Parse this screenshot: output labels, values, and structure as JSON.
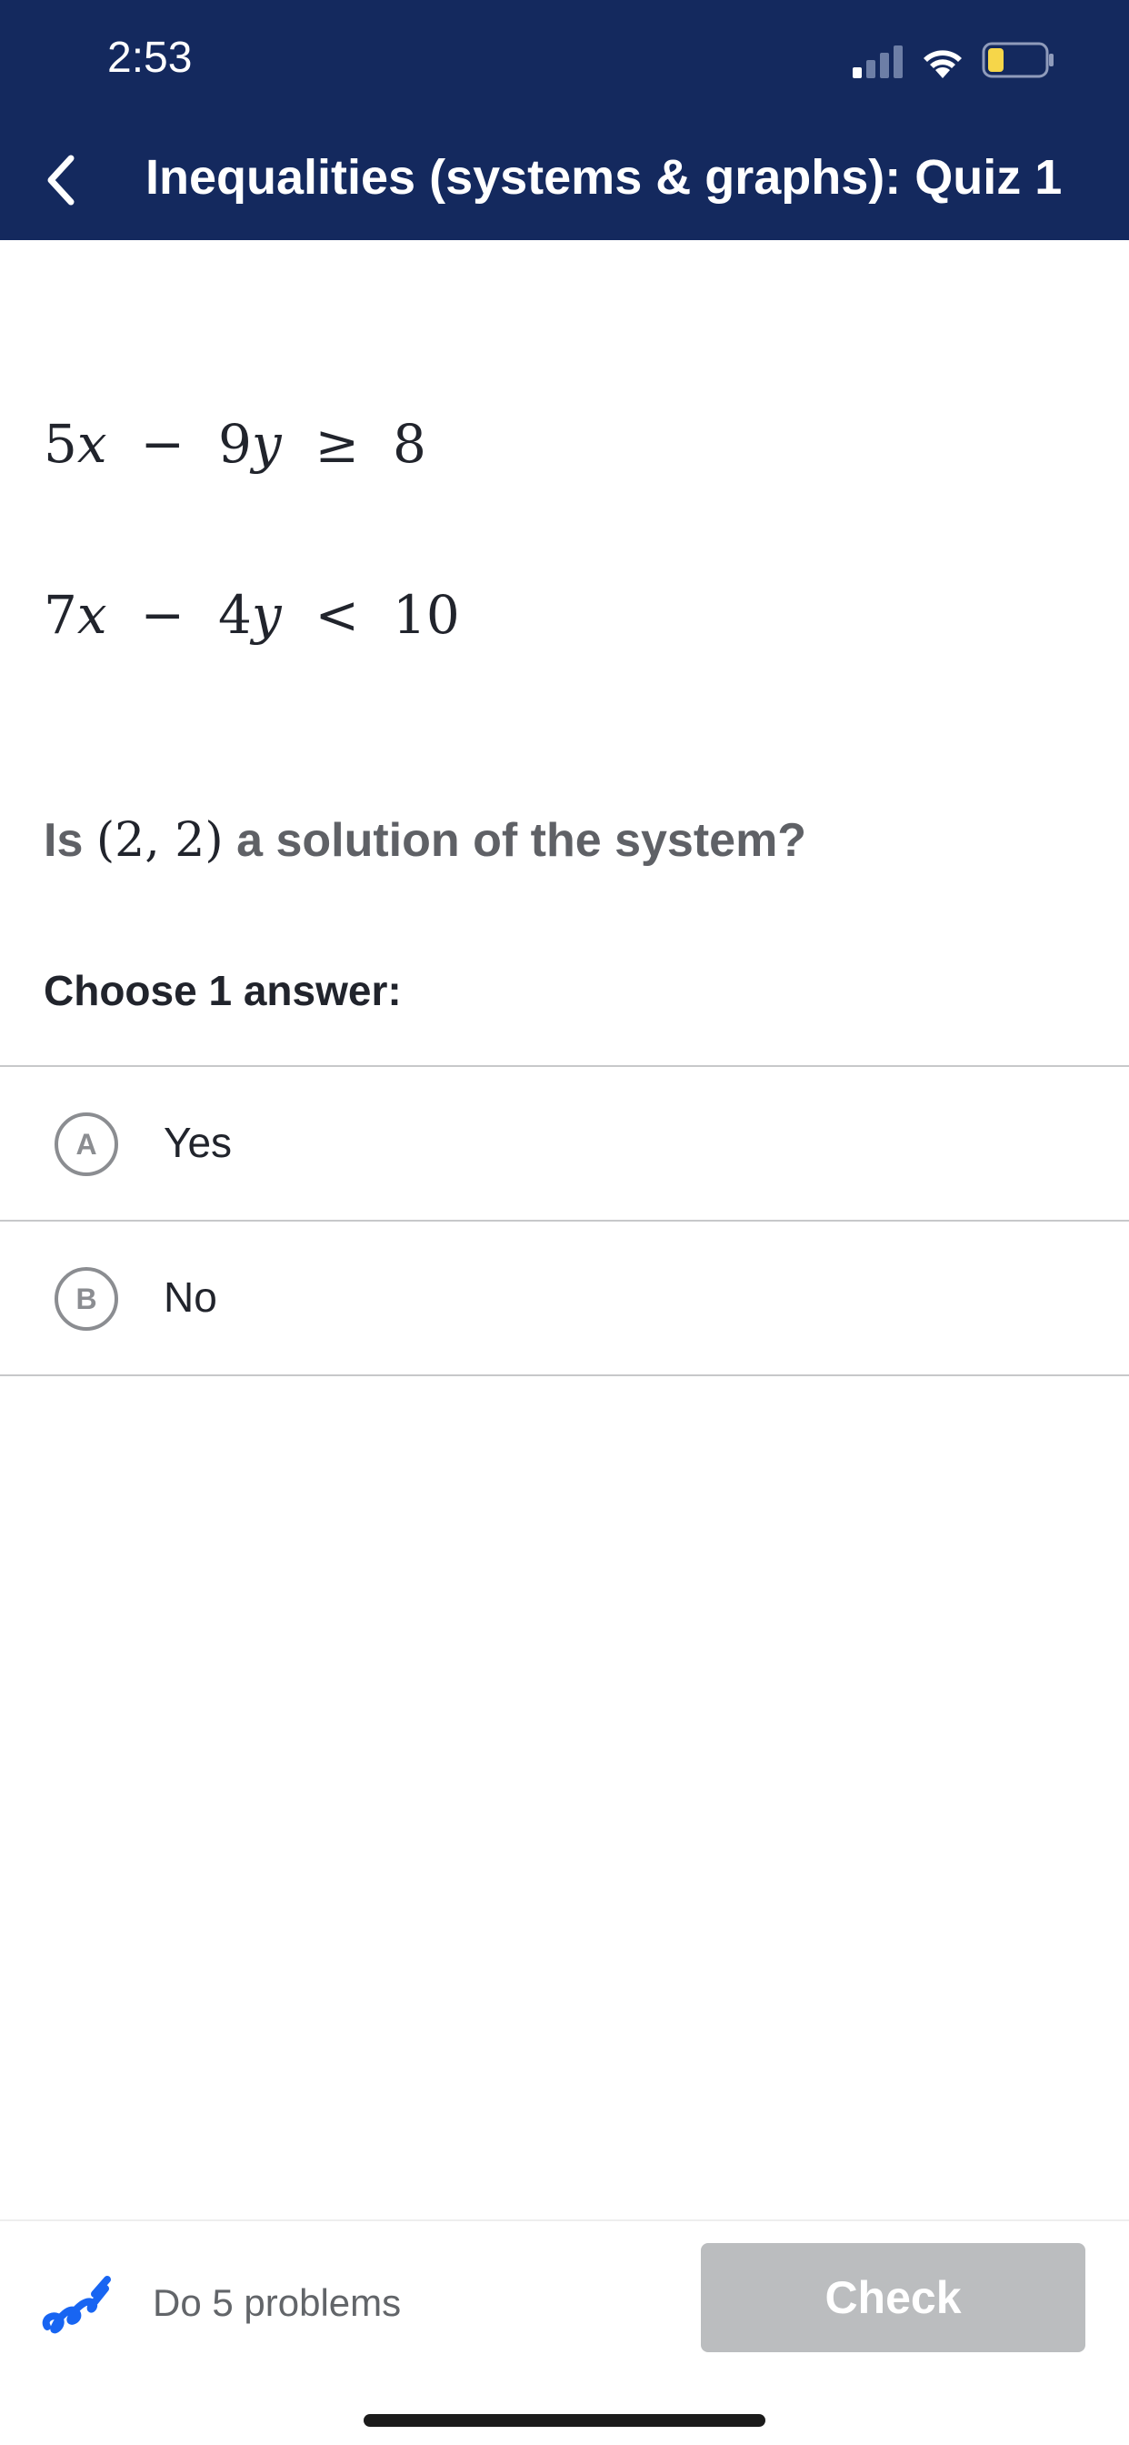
{
  "status_bar": {
    "time": "2:53",
    "signal_icon": "cellular-signal-icon",
    "wifi_icon": "wifi-icon",
    "battery_icon": "battery-icon",
    "battery_level": 0.2
  },
  "header": {
    "title": "Inequalities (systems & graphs): Quiz 1",
    "back_icon": "chevron-left-icon",
    "background_color": "#14295e"
  },
  "problem": {
    "inequality_1": {
      "a": "5",
      "x": "x",
      "op1": "−",
      "b": "9",
      "y": "y",
      "rel": "≥",
      "rhs": "8"
    },
    "inequality_2": {
      "a": "7",
      "x": "x",
      "op1": "−",
      "b": "4",
      "y": "y",
      "rel": "<",
      "rhs": "10"
    },
    "question_prefix": "Is",
    "question_point": "(2, 2)",
    "question_suffix": "a solution of the system?",
    "choose_label": "Choose 1 answer:",
    "choices": [
      {
        "letter": "A",
        "label": "Yes"
      },
      {
        "letter": "B",
        "label": "No"
      }
    ]
  },
  "footer": {
    "progress_icon": "squiggle-progress-icon",
    "progress_text": "Do 5 problems",
    "check_label": "Check",
    "accent_color": "#1865f2"
  }
}
